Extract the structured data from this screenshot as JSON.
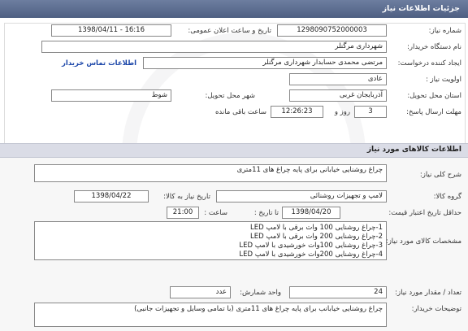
{
  "header": {
    "title": "جزئیات اطلاعات نیاز"
  },
  "info": {
    "need_number": {
      "label": "شماره نیاز:",
      "value": "1298090752000003"
    },
    "announce": {
      "label": "تاریخ و ساعت اعلان عمومی:",
      "value": "1398/04/11 - 16:16"
    },
    "buyer": {
      "label": "نام دستگاه خریدار:",
      "value": "شهرداری مرگنلر"
    },
    "creator": {
      "label": "ایجاد کننده درخواست:",
      "value": "مرتضی محمدی حسابدار شهرداری مرگنلر",
      "contact_link": "اطلاعات تماس خریدار"
    },
    "priority": {
      "label": "اولویت نیاز :",
      "value": "عادی"
    },
    "province": {
      "label": "استان محل تحویل:",
      "value": "آذربایجان غربی"
    },
    "city": {
      "label": "شهر محل تحویل:",
      "value": "شوط"
    },
    "deadline": {
      "label": "مهلت ارسال پاسخ:",
      "days": "3",
      "days_unit": "روز و",
      "time": "12:26:23",
      "time_suffix": "ساعت باقی مانده"
    }
  },
  "goods_section": {
    "title": "اطلاعات کالاهای مورد نیاز"
  },
  "goods": {
    "summary": {
      "label": "شرح کلی نیاز:",
      "value": "چراغ روشنایی خیابانی برای پایه چراغ های 11متری"
    },
    "group": {
      "label": "گروه کالا:",
      "value": "لامپ و تجهیزات روشنائی"
    },
    "need_date": {
      "label": "تاریخ نیاز به کالا:",
      "value": "1398/04/22"
    },
    "validity": {
      "label": "حداقل تاریخ اعتبار قیمت:",
      "to_date_label": "تا تاریخ :",
      "date": "1398/04/20",
      "time_label": "ساعت :",
      "time": "21:00"
    },
    "specs": {
      "label": "مشخصات کالای مورد نیاز:",
      "lines": [
        "1-چراغ روشنایی 100 وات برقی با لامپ LED",
        "2-چراغ روشنایی 200 وات برقی با لامپ LED",
        "3-چراغ روشنایی 100وات خورشیدی با لامپ LED",
        "4-چراغ روشنایی 200وات خورشیدی با لامپ LED"
      ]
    },
    "quantity": {
      "label": "تعداد / مقدار مورد نیاز:",
      "value": "24",
      "unit_label": "واحد شمارش:",
      "unit": "عدد"
    },
    "notes": {
      "label": "توضیحات خریدار:",
      "value": "چراغ روشنایی خیابانب برای پایه چراغ های 11متری (با تمامی وسایل و تجهیزات جانبی)"
    }
  }
}
